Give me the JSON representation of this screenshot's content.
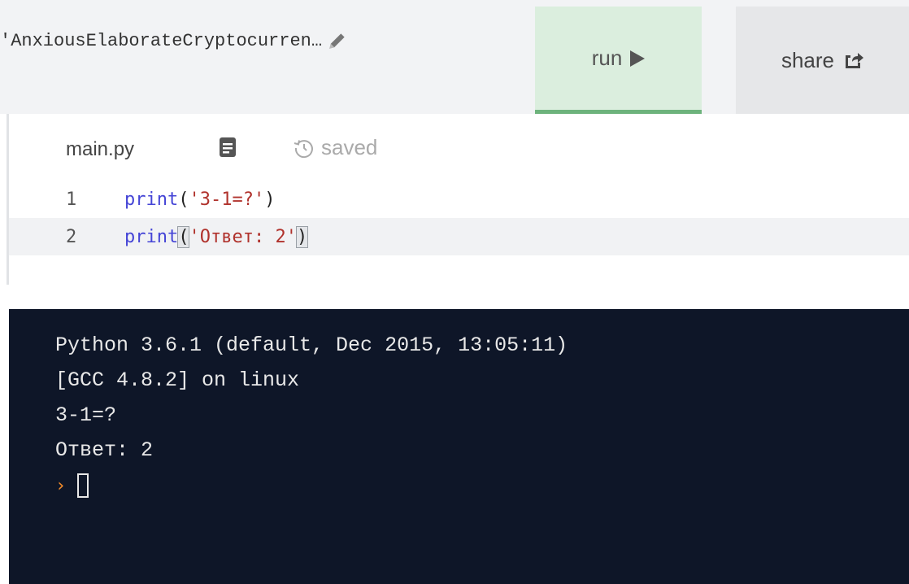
{
  "header": {
    "repl_name": "'AnxiousElaborateCryptocurren…",
    "run_label": "run",
    "share_label": "share"
  },
  "editor": {
    "tab_label": "main.py",
    "status_label": "saved",
    "lines": [
      {
        "number": "1",
        "func": "print",
        "arg": "'3-1=?'"
      },
      {
        "number": "2",
        "func": "print",
        "arg": "'Ответ: 2'"
      }
    ]
  },
  "console": {
    "lines": [
      "Python 3.6.1 (default, Dec 2015, 13:05:11)",
      "[GCC 4.8.2] on linux",
      "3-1=?",
      "Ответ: 2"
    ],
    "prompt_symbol": "›"
  },
  "colors": {
    "run_bg": "#dbeede",
    "run_accent": "#6db37c",
    "console_bg": "#0e1628",
    "keyword": "#4545d6",
    "string": "#b0322c",
    "prompt": "#f28b2a"
  },
  "icons": [
    "pencil-icon",
    "play-icon",
    "share-icon",
    "file-icon",
    "history-icon"
  ]
}
